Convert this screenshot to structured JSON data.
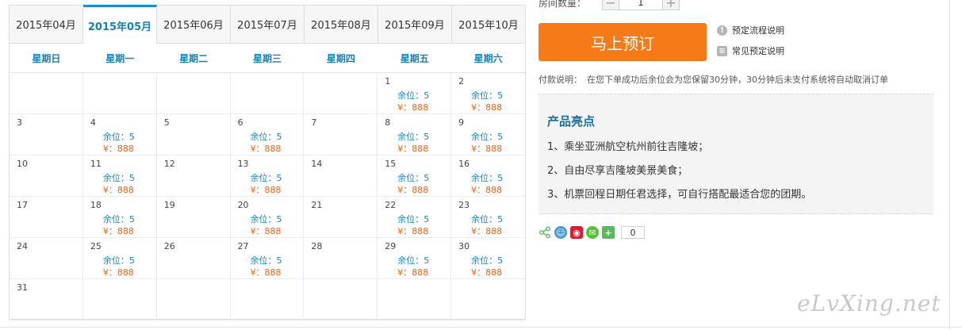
{
  "calendar": {
    "months": [
      {
        "label": "2015年04月",
        "active": false
      },
      {
        "label": "2015年05月",
        "active": true
      },
      {
        "label": "2015年06月",
        "active": false
      },
      {
        "label": "2015年07月",
        "active": false
      },
      {
        "label": "2015年08月",
        "active": false
      },
      {
        "label": "2015年09月",
        "active": false
      },
      {
        "label": "2015年10月",
        "active": false
      }
    ],
    "weekdays": [
      "星期日",
      "星期一",
      "星期二",
      "星期三",
      "星期四",
      "星期五",
      "星期六"
    ],
    "days": [
      {
        "num": "",
        "seats": "",
        "price": ""
      },
      {
        "num": "",
        "seats": "",
        "price": ""
      },
      {
        "num": "",
        "seats": "",
        "price": ""
      },
      {
        "num": "",
        "seats": "",
        "price": ""
      },
      {
        "num": "",
        "seats": "",
        "price": ""
      },
      {
        "num": "1",
        "seats": "余位：5",
        "price": "¥：888"
      },
      {
        "num": "2",
        "seats": "余位：5",
        "price": "¥：888"
      },
      {
        "num": "3",
        "seats": "",
        "price": ""
      },
      {
        "num": "4",
        "seats": "余位：5",
        "price": "¥：888"
      },
      {
        "num": "5",
        "seats": "",
        "price": ""
      },
      {
        "num": "6",
        "seats": "余位：5",
        "price": "¥：888"
      },
      {
        "num": "7",
        "seats": "",
        "price": ""
      },
      {
        "num": "8",
        "seats": "余位：5",
        "price": "¥：888"
      },
      {
        "num": "9",
        "seats": "余位：5",
        "price": "¥：888"
      },
      {
        "num": "10",
        "seats": "",
        "price": ""
      },
      {
        "num": "11",
        "seats": "余位：5",
        "price": "¥：888"
      },
      {
        "num": "12",
        "seats": "",
        "price": ""
      },
      {
        "num": "13",
        "seats": "余位：5",
        "price": "¥：888"
      },
      {
        "num": "14",
        "seats": "",
        "price": ""
      },
      {
        "num": "15",
        "seats": "余位：5",
        "price": "¥：888"
      },
      {
        "num": "16",
        "seats": "余位：5",
        "price": "¥：888"
      },
      {
        "num": "17",
        "seats": "",
        "price": ""
      },
      {
        "num": "18",
        "seats": "余位：5",
        "price": "¥：888"
      },
      {
        "num": "19",
        "seats": "",
        "price": ""
      },
      {
        "num": "20",
        "seats": "余位：5",
        "price": "¥：888"
      },
      {
        "num": "21",
        "seats": "",
        "price": ""
      },
      {
        "num": "22",
        "seats": "余位：5",
        "price": "¥：888"
      },
      {
        "num": "23",
        "seats": "余位：5",
        "price": "¥：888"
      },
      {
        "num": "24",
        "seats": "",
        "price": ""
      },
      {
        "num": "25",
        "seats": "余位：5",
        "price": "¥：888"
      },
      {
        "num": "26",
        "seats": "",
        "price": ""
      },
      {
        "num": "27",
        "seats": "余位：5",
        "price": "¥：888"
      },
      {
        "num": "28",
        "seats": "",
        "price": ""
      },
      {
        "num": "29",
        "seats": "余位：5",
        "price": "¥：888"
      },
      {
        "num": "30",
        "seats": "余位：5",
        "price": "¥：888"
      },
      {
        "num": "31",
        "seats": "",
        "price": ""
      },
      {
        "num": "",
        "seats": "",
        "price": ""
      },
      {
        "num": "",
        "seats": "",
        "price": ""
      },
      {
        "num": "",
        "seats": "",
        "price": ""
      },
      {
        "num": "",
        "seats": "",
        "price": ""
      },
      {
        "num": "",
        "seats": "",
        "price": ""
      },
      {
        "num": "",
        "seats": "",
        "price": ""
      }
    ]
  },
  "booking": {
    "room_label": "房间数量：",
    "minus_label": "−",
    "plus_label": "+",
    "quantity": "1",
    "book_label": "马上预订",
    "flow_help": "预定流程说明",
    "faq_help": "常见预定说明",
    "pay_label": "付款说明：",
    "pay_text": "在您下单成功后余位会为您保留30分钟，30分钟后未支付系统将自动取消订单"
  },
  "highlights": {
    "title": "产品亮点",
    "items": [
      "1、乘坐亚洲航空杭州前往吉隆坡；",
      "2、自由尽享吉隆坡美景美食；",
      "3、机票回程日期任君选择，可自行搭配最适合您的团期。"
    ]
  },
  "share": {
    "icons": [
      "share-icon",
      "qq-icon",
      "weibo-icon",
      "wechat-icon",
      "more-icon"
    ],
    "count": "0"
  },
  "watermark": "eLvXing.net",
  "colors": {
    "accent": "#1a7fb5",
    "book_button": "#f77a18",
    "price": "#e8631c"
  }
}
